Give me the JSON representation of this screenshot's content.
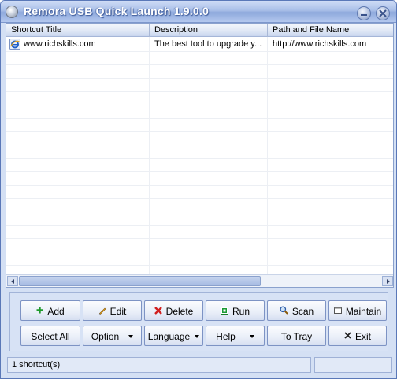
{
  "window": {
    "title": "Remora USB Quick Launch 1.9.0.0",
    "accent": "#8ea9dc"
  },
  "list": {
    "columns": [
      "Shortcut Title",
      "Description",
      "Path and File Name"
    ],
    "rows": [
      {
        "icon": "ie-icon",
        "title": "www.richskills.com",
        "description": "The best tool to upgrade y...",
        "path": "http://www.richskills.com"
      }
    ]
  },
  "buttons": {
    "add": "Add",
    "edit": "Edit",
    "delete": "Delete",
    "run": "Run",
    "scan": "Scan",
    "maintain": "Maintain",
    "select_all": "Select All",
    "option": "Option",
    "language": "Language",
    "help": "Help",
    "to_tray": "To Tray",
    "exit": "Exit"
  },
  "status": {
    "count_text": "1 shortcut(s)",
    "secondary": ""
  }
}
